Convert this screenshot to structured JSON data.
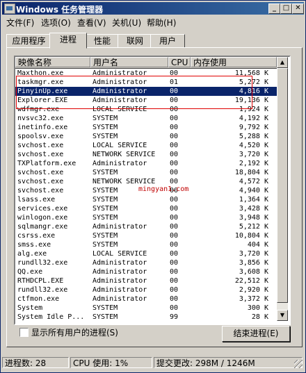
{
  "window": {
    "title": "Windows 任务管理器",
    "min": "_",
    "max": "□",
    "close": "✕"
  },
  "menu": [
    "文件(F)",
    "选项(O)",
    "查看(V)",
    "关机(U)",
    "帮助(H)"
  ],
  "tabs": [
    "应用程序",
    "进程",
    "性能",
    "联网",
    "用户"
  ],
  "active_tab": "进程",
  "columns": [
    "映像名称",
    "用户名",
    "CPU",
    "内存使用"
  ],
  "processes": [
    [
      "Maxthon.exe",
      "Administrator",
      "00",
      "11,568 K"
    ],
    [
      "taskmgr.exe",
      "Administrator",
      "01",
      "5,272 K"
    ],
    [
      "PinyinUp.exe",
      "Administrator",
      "00",
      "4,816 K"
    ],
    [
      "Explorer.EXE",
      "Administrator",
      "00",
      "19,136 K"
    ],
    [
      "wdfmgr.exe",
      "LOCAL SERVICE",
      "00",
      "1,924 K"
    ],
    [
      "nvsvc32.exe",
      "SYSTEM",
      "00",
      "4,192 K"
    ],
    [
      "inetinfo.exe",
      "SYSTEM",
      "00",
      "9,792 K"
    ],
    [
      "spoolsv.exe",
      "SYSTEM",
      "00",
      "5,288 K"
    ],
    [
      "svchost.exe",
      "LOCAL SERVICE",
      "00",
      "4,520 K"
    ],
    [
      "svchost.exe",
      "NETWORK SERVICE",
      "00",
      "3,720 K"
    ],
    [
      "TXPlatform.exe",
      "Administrator",
      "00",
      "2,192 K"
    ],
    [
      "svchost.exe",
      "SYSTEM",
      "00",
      "18,804 K"
    ],
    [
      "svchost.exe",
      "NETWORK SERVICE",
      "00",
      "4,572 K"
    ],
    [
      "svchost.exe",
      "SYSTEM",
      "00",
      "4,940 K"
    ],
    [
      "lsass.exe",
      "SYSTEM",
      "00",
      "1,364 K"
    ],
    [
      "services.exe",
      "SYSTEM",
      "00",
      "3,428 K"
    ],
    [
      "winlogon.exe",
      "SYSTEM",
      "00",
      "3,948 K"
    ],
    [
      "sqlmangr.exe",
      "Administrator",
      "00",
      "5,212 K"
    ],
    [
      "csrss.exe",
      "SYSTEM",
      "00",
      "10,804 K"
    ],
    [
      "smss.exe",
      "SYSTEM",
      "00",
      "404 K"
    ],
    [
      "alg.exe",
      "LOCAL SERVICE",
      "00",
      "3,720 K"
    ],
    [
      "rundll32.exe",
      "Administrator",
      "00",
      "3,856 K"
    ],
    [
      "QQ.exe",
      "Administrator",
      "00",
      "3,608 K"
    ],
    [
      "RTHDCPL.EXE",
      "Administrator",
      "00",
      "22,512 K"
    ],
    [
      "rundll32.exe",
      "Administrator",
      "00",
      "2,920 K"
    ],
    [
      "ctfmon.exe",
      "Administrator",
      "00",
      "3,372 K"
    ],
    [
      "System",
      "SYSTEM",
      "00",
      "300 K"
    ],
    [
      "System Idle P...",
      "SYSTEM",
      "99",
      "28 K"
    ]
  ],
  "selected_index": 2,
  "watermark": "mingyan1.com",
  "show_all_users": "显示所有用户的进程(S)",
  "end_process": "结束进程(E)",
  "status": {
    "processes": "进程数: 28",
    "cpu": "CPU 使用: 1%",
    "commit": "提交更改: 298M / 1246M"
  },
  "colors": {
    "title_start": "#0a246a",
    "selection": "#0a246a",
    "highlight_box": "#e00000"
  }
}
